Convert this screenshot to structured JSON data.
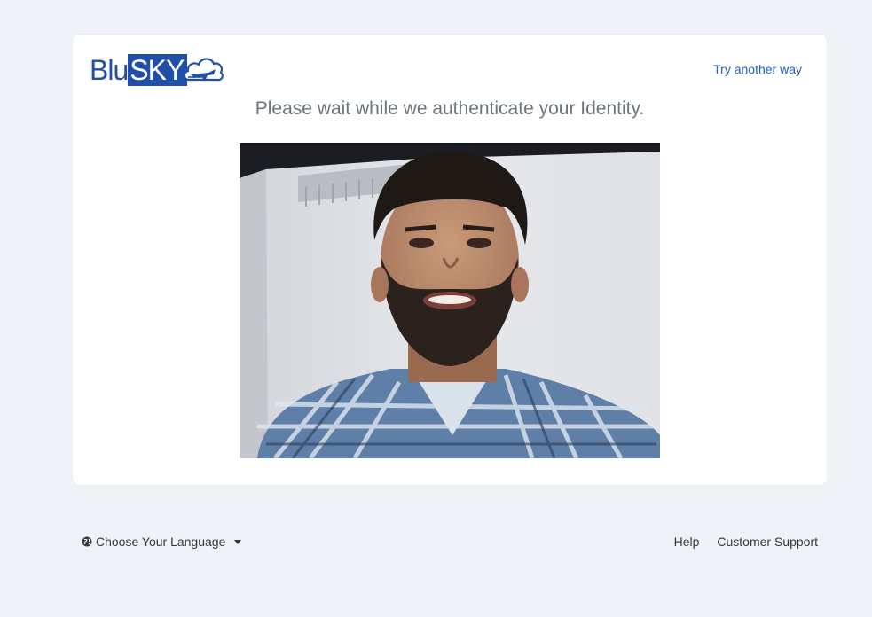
{
  "header": {
    "logo_text_blu": "Blu",
    "logo_text_sky": "SKY",
    "try_another_way": "Try another way"
  },
  "main": {
    "heading": "Please wait while we authenticate your Identity."
  },
  "footer": {
    "language_label": "Choose Your Language",
    "help_label": "Help",
    "support_label": "Customer Support"
  },
  "colors": {
    "brand_blue": "#1f4fa8",
    "link_blue": "#1f5fbf",
    "page_bg": "#eff2f6"
  }
}
